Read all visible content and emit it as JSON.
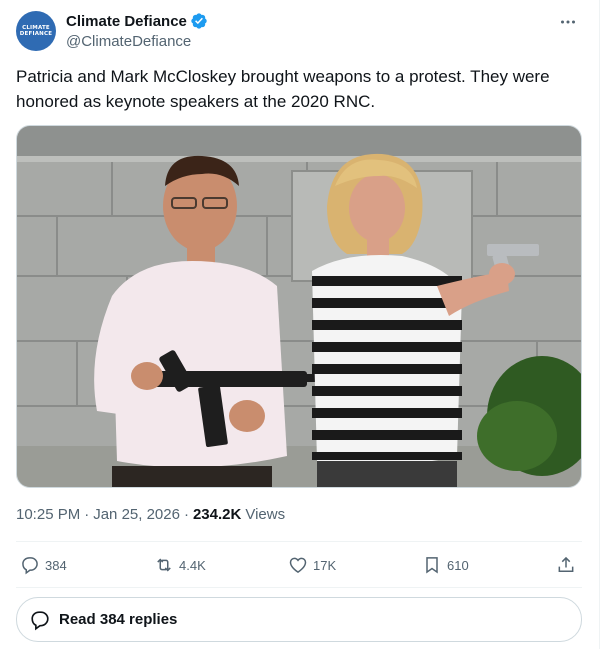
{
  "author": {
    "name": "Climate Defiance",
    "handle": "@ClimateDefiance",
    "avatar_text": [
      "CLIMATE",
      "DEFIANCE"
    ],
    "avatar_color": "#2f6bb3",
    "verified_badge_color": "#1d9bf0"
  },
  "tweet": {
    "text": "Patricia and Mark McCloskey brought weapons to a protest. They were honored as keynote speakers at the 2020 RNC.",
    "time": "10:25 PM",
    "date": "Jan 25, 2026",
    "views_count": "234.2K",
    "views_label": "Views",
    "separator": "·"
  },
  "media": {
    "subject": "photo of a man holding a rifle and a woman in a striped shirt pointing a pistol, in front of a stone building"
  },
  "actions": {
    "replies": "384",
    "reposts": "4.4K",
    "likes": "17K",
    "bookmarks": "610"
  },
  "read_replies": {
    "label": "Read 384 replies"
  },
  "icons": {
    "more": "more-icon",
    "reply": "reply-icon",
    "repost": "repost-icon",
    "like": "like-icon",
    "bookmark": "bookmark-icon",
    "share": "share-icon"
  }
}
